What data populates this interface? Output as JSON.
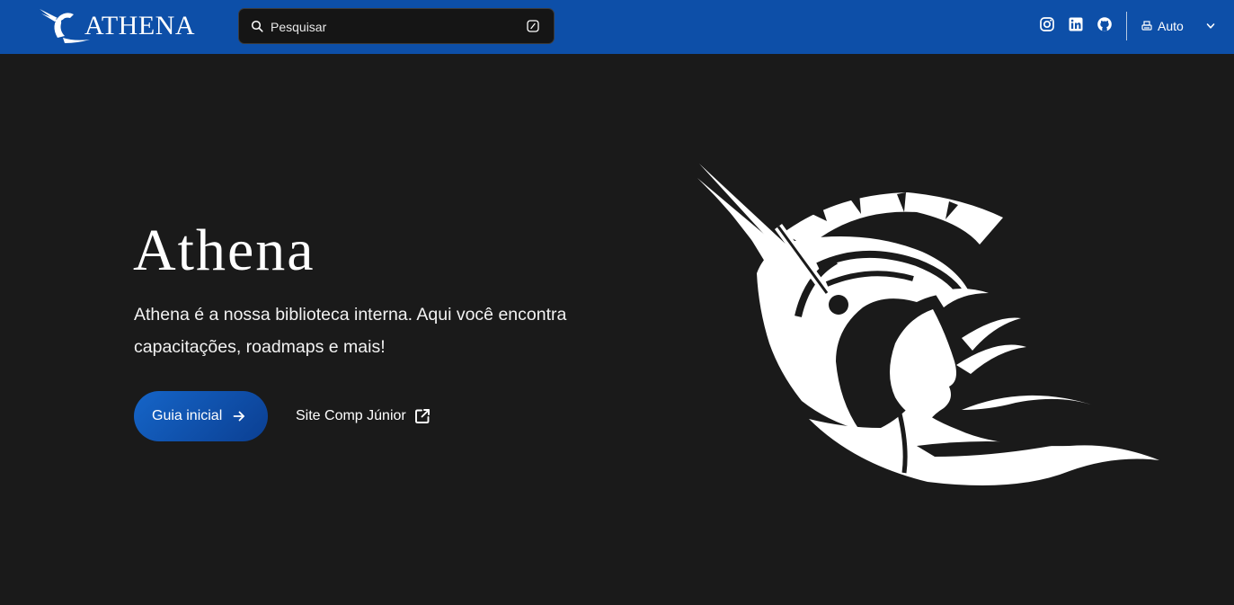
{
  "header": {
    "brand": "ATHENA",
    "search": {
      "placeholder": "Pesquisar",
      "icon": "search-icon",
      "shortcut_icon": "keyboard-shortcut-icon"
    },
    "social": [
      {
        "name": "instagram",
        "icon": "instagram-icon"
      },
      {
        "name": "linkedin",
        "icon": "linkedin-icon"
      },
      {
        "name": "github",
        "icon": "github-icon"
      }
    ],
    "theme": {
      "label": "Auto",
      "icon": "printer-icon"
    }
  },
  "hero": {
    "title": "Athena",
    "tagline": "Athena é a nossa biblioteca interna. Aqui você encontra capacitações, roadmaps e mais!",
    "primary_button": "Guia inicial",
    "secondary_link": "Site Comp Júnior"
  },
  "colors": {
    "navbar": "#0d4fa8",
    "background": "#1a1a1a",
    "button_gradient_start": "#1565c8",
    "button_gradient_end": "#0b3f92",
    "text": "#ffffff"
  }
}
